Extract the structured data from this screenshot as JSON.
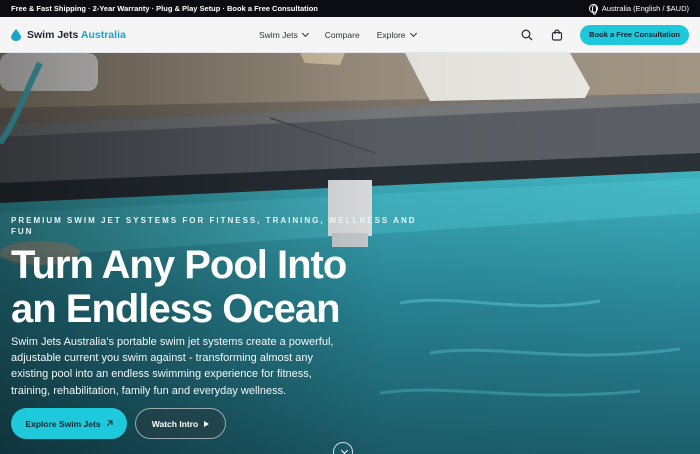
{
  "topbar": {
    "announcement": "Free & Fast Shipping · 2-Year Warranty · Plug & Play Setup · Book a Free Consultation",
    "locale": "Australia (English / $AUD)",
    "locale_icon": "globe-icon"
  },
  "header": {
    "brand_name": "Swim Jets",
    "brand_accent": "Australia",
    "logo_icon": "water-drop-icon",
    "nav": [
      {
        "label": "Swim Jets",
        "has_dropdown": true
      },
      {
        "label": "Compare",
        "has_dropdown": false
      },
      {
        "label": "Explore",
        "has_dropdown": true
      }
    ],
    "search_icon": "search-icon",
    "cart_icon": "cart-icon",
    "cta_label": "Book a Free Consultation"
  },
  "hero": {
    "eyebrow": "PREMIUM SWIM JET SYSTEMS FOR FITNESS, TRAINING, WELLNESS AND FUN",
    "headline_line1": "Turn Any Pool Into",
    "headline_line2": "an Endless Ocean",
    "subtext": "Swim Jets Australia's portable swim jet systems create a powerful, adjustable current you swim against - transforming almost any existing pool into an endless swimming experience for fitness, training, rehabilitation, family fun and everyday wellness.",
    "primary_button": "Explore Swim Jets",
    "primary_button_icon": "arrow-up-right-icon",
    "secondary_button": "Watch Intro",
    "secondary_button_icon": "play-icon",
    "scroll_icon": "chevron-down-icon"
  },
  "colors": {
    "accent": "#1ec7d9",
    "brand_accent": "#1aa4c8",
    "topbar_bg": "#0b0d12"
  }
}
